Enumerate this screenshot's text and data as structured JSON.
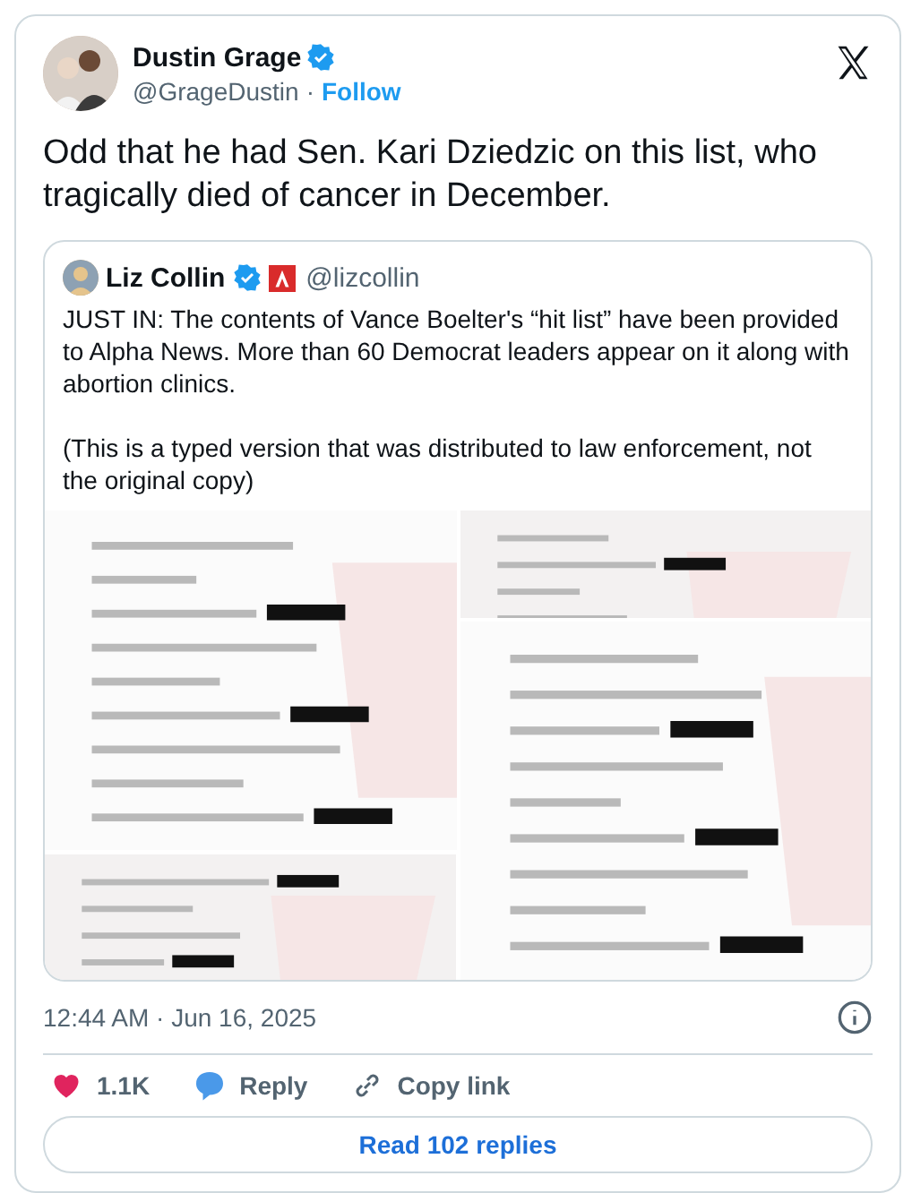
{
  "author": {
    "name": "Dustin Grage",
    "verified": true,
    "handle": "@GrageDustin",
    "separator": "·",
    "follow": "Follow"
  },
  "text": "Odd that he had Sen. Kari Dziedzic on this list, who tragically died of cancer in December.",
  "quote": {
    "name": "Liz Collin",
    "verified": true,
    "handle": "@lizcollin",
    "text": "JUST IN: The contents of Vance Boelter's “hit list” have been provided to Alpha News. More than 60 Democrat leaders appear on it along with abortion clinics.",
    "text2": "(This is a typed version that was distributed to law enforcement, not the original copy)"
  },
  "timestamp": "12:44 AM · Jun 16, 2025",
  "actions": [
    {
      "kind": "like",
      "label": "1.1K"
    },
    {
      "kind": "reply",
      "label": "Reply"
    },
    {
      "kind": "copy",
      "label": "Copy link"
    }
  ],
  "read_replies": "Read 102 replies"
}
